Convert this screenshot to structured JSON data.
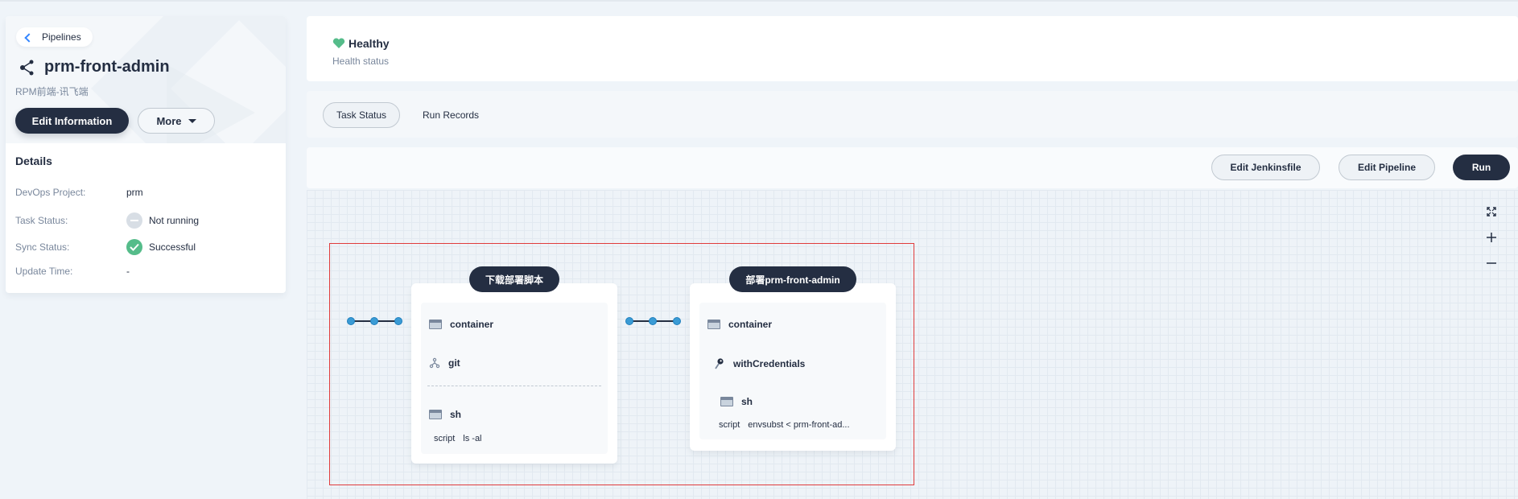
{
  "sidebar": {
    "back_label": "Pipelines",
    "title": "prm-front-admin",
    "subtitle": "RPM前端-讯飞端",
    "edit_button": "Edit Information",
    "more_button": "More",
    "details_heading": "Details",
    "details": [
      {
        "key": "DevOps Project:",
        "value": "prm"
      },
      {
        "key": "Task Status:",
        "value": "Not running",
        "icon": "not-running-icon"
      },
      {
        "key": "Sync Status:",
        "value": "Successful",
        "icon": "success-check-icon"
      },
      {
        "key": "Update Time:",
        "value": "-"
      }
    ]
  },
  "health": {
    "title": "Healthy",
    "label": "Health status",
    "color": "#55bc8a"
  },
  "tabs": [
    {
      "label": "Task Status",
      "active": true
    },
    {
      "label": "Run Records",
      "active": false
    }
  ],
  "toolbar": {
    "edit_jenkinsfile": "Edit Jenkinsfile",
    "edit_pipeline": "Edit Pipeline",
    "run": "Run"
  },
  "canvas_controls": [
    "fullscreen-icon",
    "zoom-in-icon",
    "zoom-out-icon"
  ],
  "stages": [
    {
      "name": "下载部署脚本",
      "steps": [
        {
          "label": "container",
          "icon": "terminal-icon"
        },
        {
          "label": "git",
          "icon": "git-branch-icon"
        },
        {
          "label": "sh",
          "icon": "terminal-icon",
          "script_label": "script",
          "script_value": "ls -al"
        }
      ]
    },
    {
      "name": "部署prm-front-admin",
      "steps": [
        {
          "label": "container",
          "icon": "terminal-icon"
        },
        {
          "label": "withCredentials",
          "icon": "key-icon"
        },
        {
          "label": "sh",
          "icon": "terminal-icon",
          "script_label": "script",
          "script_value": "envsubst < prm-front-ad..."
        }
      ]
    }
  ],
  "colors": {
    "dark": "#242e42",
    "accent": "#3385ff",
    "selection": "#e03c3c",
    "connector": "#3a9bd5"
  }
}
